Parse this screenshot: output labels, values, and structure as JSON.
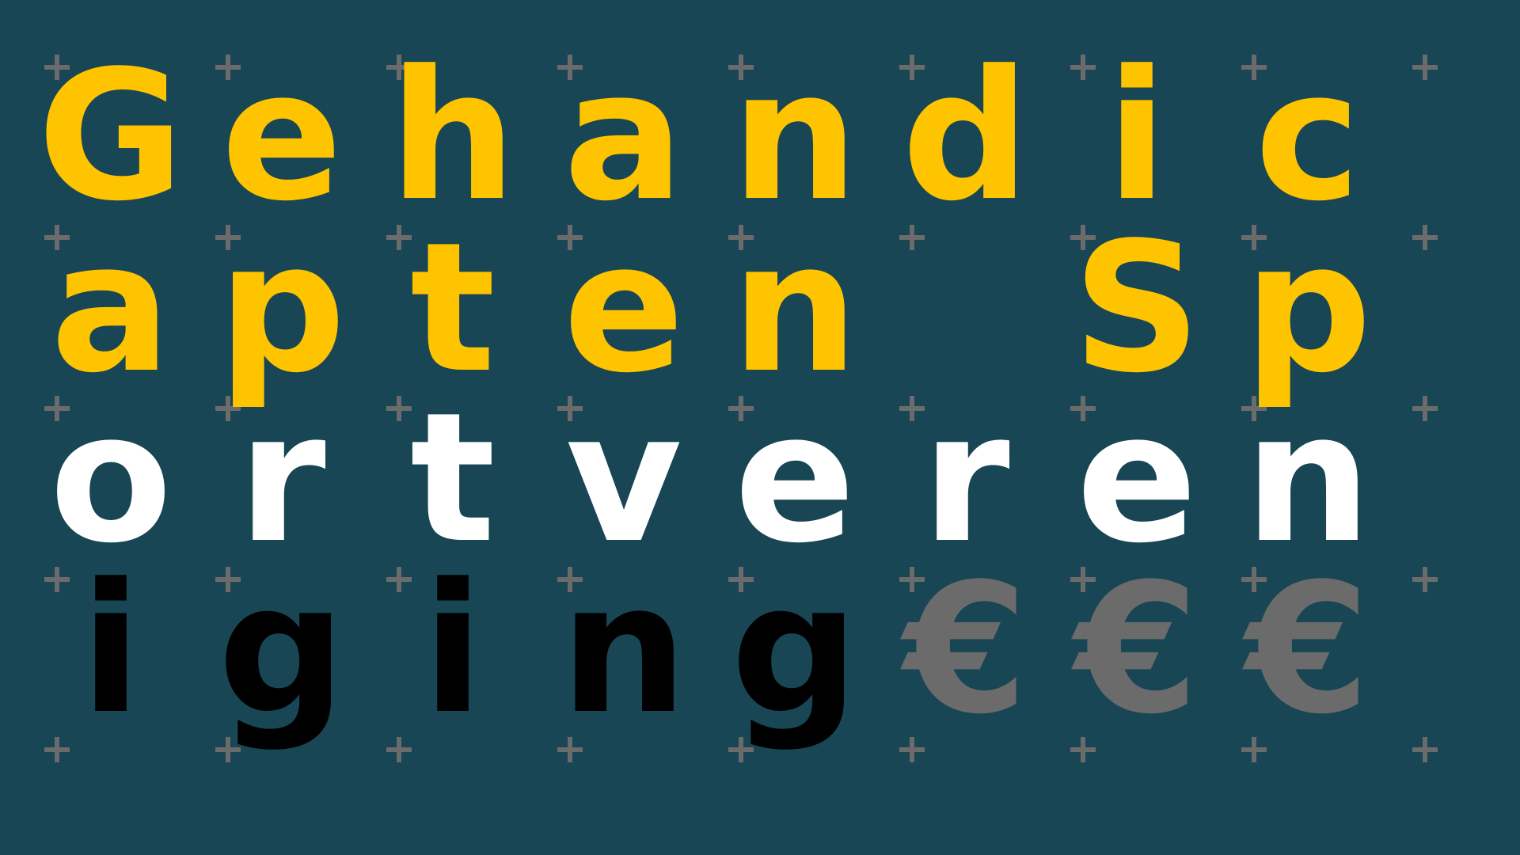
{
  "colors": {
    "background": "#184655",
    "plus": "#6b6b6b",
    "yellow": "#ffc400",
    "white": "#ffffff",
    "black": "#000000",
    "gray": "#6b6b6b"
  },
  "rows": [
    {
      "color": "yellow",
      "cells": [
        "G",
        "e",
        "h",
        "a",
        "n",
        "d",
        "i",
        "c"
      ]
    },
    {
      "color": "yellow",
      "cells": [
        "a",
        "p",
        "t",
        "e",
        "n",
        " ",
        "S",
        "p"
      ]
    },
    {
      "color": "white",
      "cells": [
        "o",
        "r",
        "t",
        "v",
        "e",
        "r",
        "e",
        "n"
      ]
    },
    {
      "color": "black",
      "cells": [
        "i",
        "g",
        "i",
        "n",
        "g",
        "€",
        "€",
        "€"
      ],
      "cell_colors": [
        "black",
        "black",
        "black",
        "black",
        "black",
        "gray",
        "gray",
        "gray"
      ]
    }
  ]
}
